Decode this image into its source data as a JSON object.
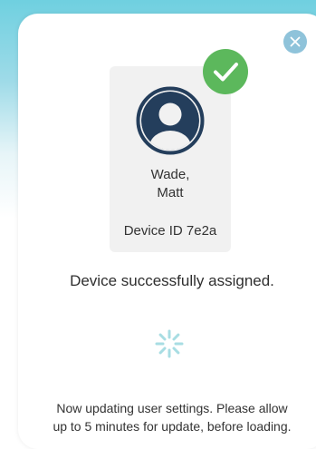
{
  "colors": {
    "backdrop_accent": "#6fd0e0",
    "close_button": "#8fc3da",
    "avatar": "#243e5c",
    "success_check": "#5cb85c",
    "spinner": "#a8dde3",
    "card_background": "#f1f1f1"
  },
  "icons": {
    "close": "close-icon",
    "avatar": "user-avatar-icon",
    "check": "checkmark-icon",
    "spinner": "loading-spinner-icon"
  },
  "user": {
    "last_name_line": "Wade,",
    "first_name_line": "Matt",
    "device_id": "Device ID 7e2a"
  },
  "messages": {
    "success": "Device successfully assigned.",
    "status_line1": "Now updating user settings. Please allow",
    "status_line2": "up to 5 minutes for update, before loading."
  }
}
